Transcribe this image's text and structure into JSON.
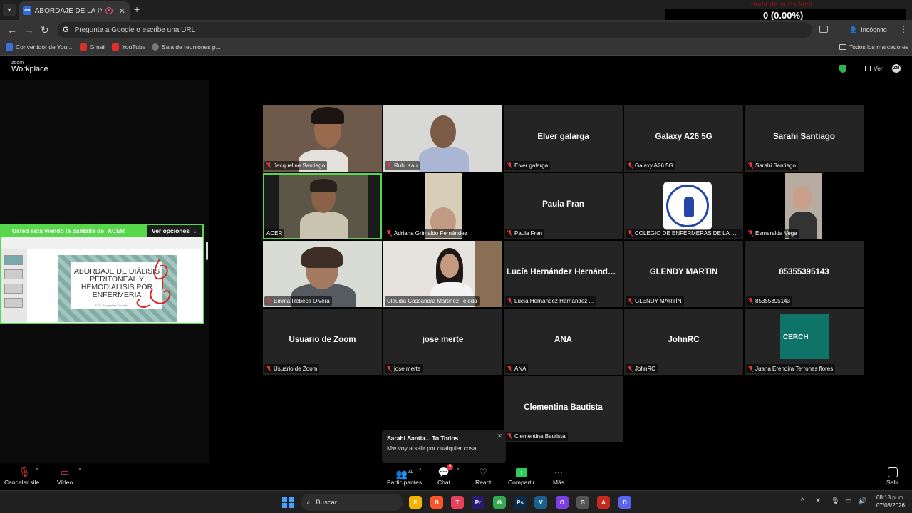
{
  "browser": {
    "tab_title": "ABORDAJE DE LA INSUFICIEN",
    "tab_favicon_text": "zm",
    "new_tab": "+",
    "tab_close": "✕",
    "omnibox_placeholder": "Pregunta a Google o escribe una URL",
    "incognito_label": "Incógnito",
    "bookmarks": [
      {
        "label": "Convertidor de You...",
        "color": "#3b6fd8"
      },
      {
        "label": "Gmail",
        "color": "#d93025"
      },
      {
        "label": "YouTube",
        "color": "#e52d27"
      },
      {
        "label": "Sala de reuniones p...",
        "color": "#777777"
      }
    ],
    "all_bookmarks": "Todos los marcadores"
  },
  "overlay": {
    "title": "meta de subs kick",
    "value": "0 (0.00%)",
    "zero": "0"
  },
  "zoom": {
    "logo_top": "zoom",
    "logo_main": "Workplace",
    "view_label": "Ver",
    "avatar_initials": "ZM",
    "share_banner": {
      "text": "Usted está viendo la pantalla de",
      "presenter": "ACER",
      "options": "Ver opciones"
    },
    "slide": {
      "title": "ABORDAJE DE DIÁLISIS PERITONEAL Y HEMODIALISIS POR ENFERMERIA",
      "subtitle": "L.E.E.I. Jacqueline Sánchez"
    },
    "tiles": [
      {
        "name": "Jacqueline Santiago",
        "video": true
      },
      {
        "name": "Rubi Kau",
        "video": true
      },
      {
        "name": "Elver galarga",
        "video": false
      },
      {
        "name": "Galaxy A26 5G",
        "video": false
      },
      {
        "name": "Sarahi Santiago",
        "video": false
      },
      {
        "name": "ACER",
        "video": true
      },
      {
        "name": "Adriana Grimaldo Fernández",
        "video": true
      },
      {
        "name": "Paula Fran",
        "video": false
      },
      {
        "name": "COLEGIO DE ENFERMERAS DE LA CIUD...",
        "video": true
      },
      {
        "name": "Esmeralda Vega",
        "video": true
      },
      {
        "name": "Emma Rebeca Olvera",
        "video": true
      },
      {
        "name": "Claudia Cassandra Martinez Tejeda",
        "video": true
      },
      {
        "name": "Lucía Hernández Hernández ...",
        "video": false
      },
      {
        "name": "GLENDY MARTÍN",
        "video": false
      },
      {
        "name": "85355395143",
        "video": false
      },
      {
        "name": "Usuario de Zoom",
        "video": false
      },
      {
        "name": "jose merte",
        "video": false
      },
      {
        "name": "ANA",
        "video": false
      },
      {
        "name": "JohnRC",
        "video": false
      },
      {
        "name": "Juana Erendira Terrones flores",
        "video": true
      },
      {
        "name": "Clementina Bautista",
        "video": false
      }
    ],
    "center_names": {
      "elver": "Elver galarga",
      "galaxy": "Galaxy A26 5G",
      "sarahi": "Sarahi Santiago",
      "paula": "Paula Fran",
      "lucia": "Lucía Hernández Hernández...",
      "glendy": "GLENDY MARTÍN",
      "num": "85355395143",
      "usuario": "Usuario de Zoom",
      "jose": "jose merte",
      "ana": "ANA",
      "john": "JohnRC",
      "clementina": "Clementina Bautista"
    },
    "cerch_text": "CERCH",
    "chat_toast": {
      "sender": "Sarahi Santia... To Todos",
      "message": "Mw voy a salir por cualquier cosa"
    },
    "toolbar": {
      "mute": "Cancelar sile...",
      "video": "Vídeo",
      "participants": "Participantes",
      "participants_count": "21",
      "chat": "Chat",
      "chat_badge": "5",
      "react": "React",
      "share": "Compartir",
      "more": "Más",
      "leave": "Salir"
    }
  },
  "taskbar": {
    "search": "Buscar",
    "time": "08:18 p. m.",
    "date": "07/08/2026",
    "apps": [
      {
        "label": "F",
        "color": "#f4b400"
      },
      {
        "label": "B",
        "color": "#fb542b"
      },
      {
        "label": "T",
        "color": "#e7405c"
      },
      {
        "label": "Pr",
        "color": "#2a1a6e"
      },
      {
        "label": "G",
        "color": "#34a853"
      },
      {
        "label": "Ps",
        "color": "#0b2a4a"
      },
      {
        "label": "V",
        "color": "#1b5f8c"
      },
      {
        "label": "O",
        "color": "#7b3fe4"
      },
      {
        "label": "S",
        "color": "#555555"
      },
      {
        "label": "A",
        "color": "#c42b1c"
      },
      {
        "label": "D",
        "color": "#5865f2"
      }
    ]
  }
}
